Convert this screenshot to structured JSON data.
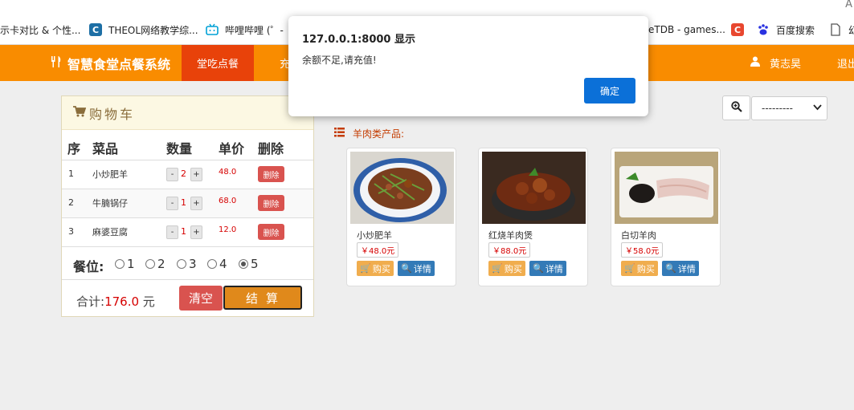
{
  "browser": {
    "corner_glyph": "A",
    "bookmarks": [
      {
        "icon": "none",
        "label": "示卡对比 & 个性..."
      },
      {
        "icon": "theol-c-icon",
        "label": "THEOL网络教学综..."
      },
      {
        "icon": "bilibili-icon",
        "label": "哔哩哔哩 (゜-"
      },
      {
        "icon": "none",
        "label": "eTDB - games..."
      },
      {
        "icon": "c-icon",
        "label": ""
      },
      {
        "icon": "baidu-paw-icon",
        "label": "百度搜索"
      },
      {
        "icon": "document-icon",
        "label": "幻"
      }
    ]
  },
  "navbar": {
    "brand": "智慧食堂点餐系统",
    "active_tab": "堂吃点餐",
    "tab2_partial": "充",
    "user": "黄志昊",
    "logout": "退出",
    "color": "#f98c00",
    "active_color": "#e8420a"
  },
  "cart": {
    "title": "购物车",
    "columns": {
      "no": "序",
      "name": "菜品",
      "qty": "数量",
      "price": "单价",
      "delete": "删除"
    },
    "minus_label": "-",
    "plus_label": "+",
    "delete_label": "删除",
    "items": [
      {
        "no": "1",
        "name": "小炒肥羊",
        "qty": "2",
        "price": "48.0"
      },
      {
        "no": "2",
        "name": "牛腩锅仔",
        "qty": "1",
        "price": "68.0"
      },
      {
        "no": "3",
        "name": "麻婆豆腐",
        "qty": "1",
        "price": "12.0"
      }
    ],
    "seat_label": "餐位:",
    "seats": [
      "1",
      "2",
      "3",
      "4",
      "5"
    ],
    "selected_seat": "5",
    "total_label": "合计:",
    "total_value": "176.0",
    "total_unit": "元",
    "clear_label": "清空",
    "checkout_label": "结算"
  },
  "search": {
    "select_value": "---------"
  },
  "category": {
    "label": "羊肉类产品:"
  },
  "products": [
    {
      "name": "小炒肥羊",
      "price": "￥48.0元",
      "buy": "购买",
      "detail": "详情"
    },
    {
      "name": "红烧羊肉煲",
      "price": "￥88.0元",
      "buy": "购买",
      "detail": "详情"
    },
    {
      "name": "白切羊肉",
      "price": "￥58.0元",
      "buy": "购买",
      "detail": "详情"
    }
  ],
  "dialog": {
    "title": "127.0.0.1:8000 显示",
    "message": "余额不足,请充值!",
    "ok": "确定"
  }
}
